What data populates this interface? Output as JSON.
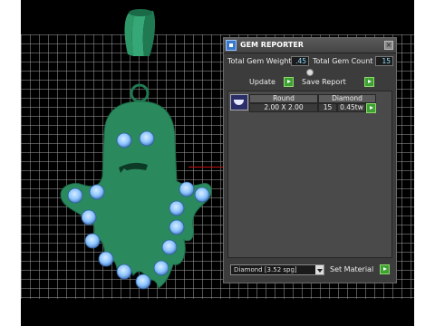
{
  "panel": {
    "title": "GEM REPORTER",
    "close_icon": "close-icon",
    "total_gem_weight_label": "Total Gem Weight",
    "total_gem_weight_value": ".45",
    "total_gem_count_label": "Total Gem Count",
    "total_gem_count_value": "15",
    "update_label": "Update",
    "save_report_label": "Save Report",
    "table": {
      "headers": [
        "Round",
        "Diamond"
      ],
      "rows": [
        {
          "size": "2.00 X 2.00",
          "count": "15",
          "weight": "0.45tw"
        }
      ]
    },
    "material_select": "Diamond   [3.52 spg]",
    "set_material_label": "Set Material"
  },
  "colors": {
    "model": "#2a8a5e",
    "gem": "#8ec6ff",
    "accent_green": "#3fa036",
    "panel_bg": "#3c3c3c"
  }
}
